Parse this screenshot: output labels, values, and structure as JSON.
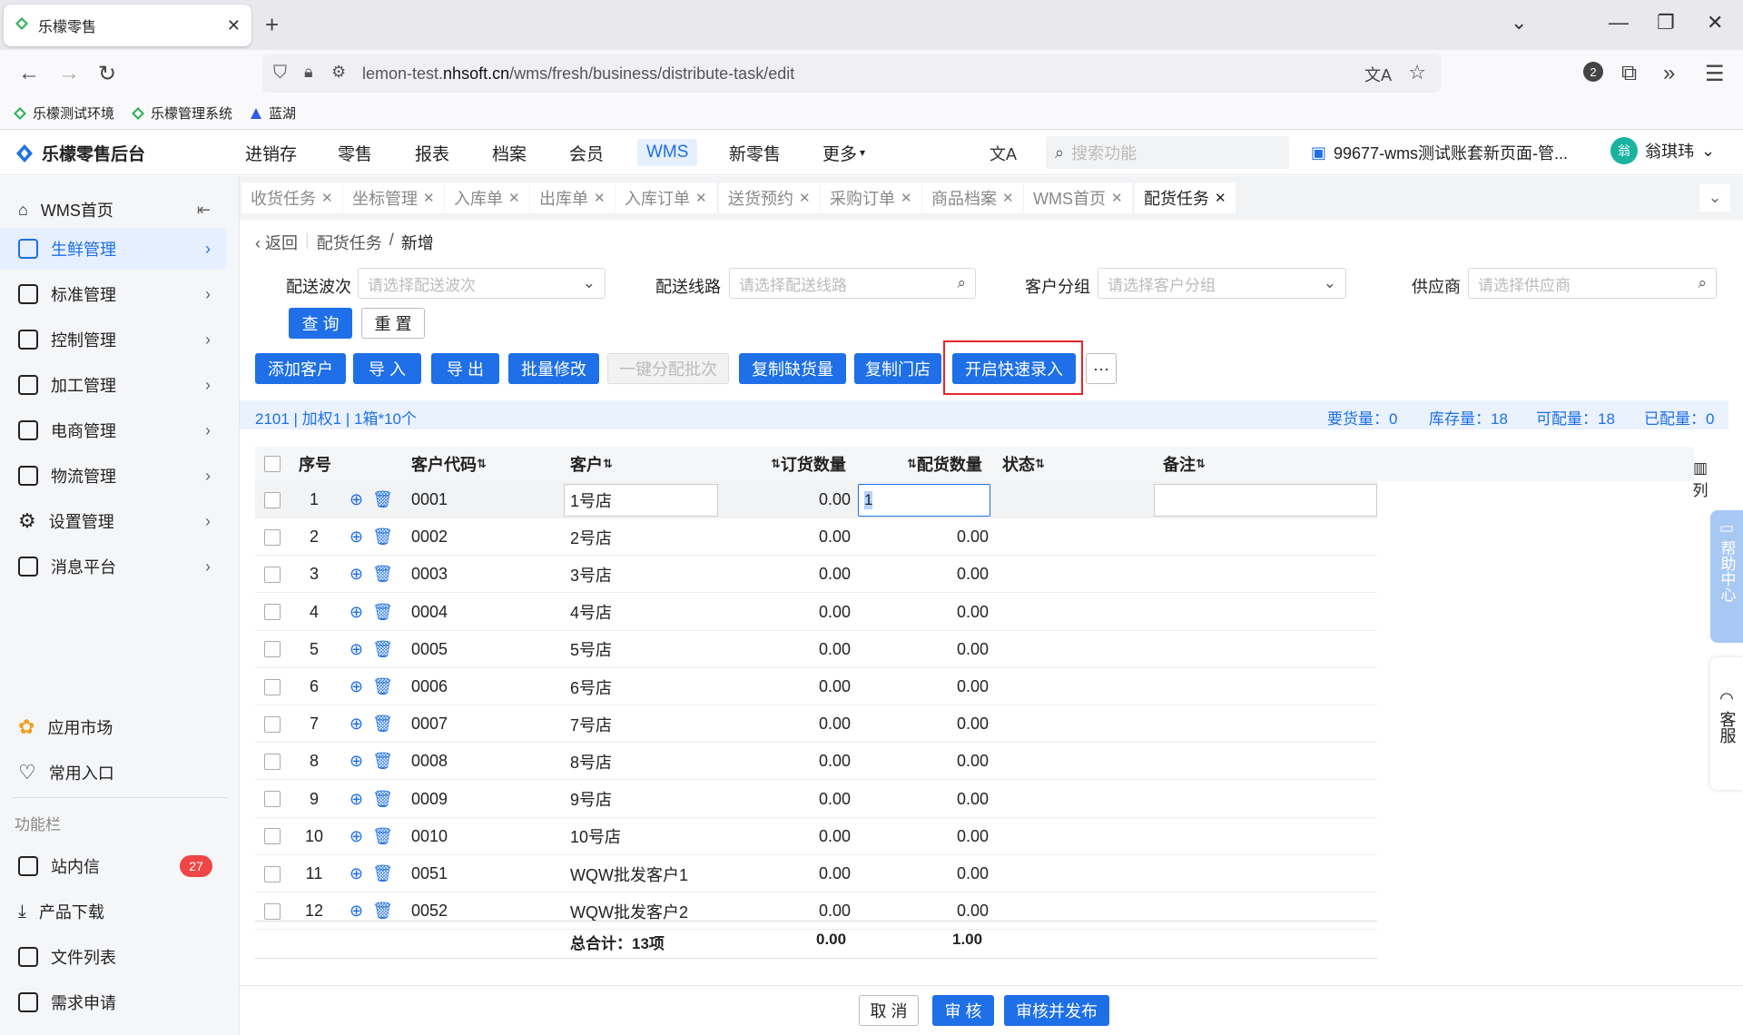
{
  "browser": {
    "tab_title": "乐檬零售",
    "tab_close": "✕",
    "new_tab": "+",
    "url_prefix": "lemon-test.",
    "url_domain": "nhsoft.cn",
    "url_path": "/wms/fresh/business/distribute-task/edit",
    "ext_badge": "2",
    "bookmarks": [
      "乐檬测试环境",
      "乐檬管理系统",
      "蓝湖"
    ]
  },
  "app": {
    "brand": "乐檬零售后台",
    "topnav": [
      "进销存",
      "零售",
      "报表",
      "档案",
      "会员",
      "WMS",
      "新零售",
      "更多"
    ],
    "search_placeholder": "搜索功能",
    "account": "99677-wms测试账套新页面-管...",
    "avatar_char": "翁",
    "user_name": "翁琪玮"
  },
  "sidebar": {
    "items": [
      "WMS首页",
      "生鲜管理",
      "标准管理",
      "控制管理",
      "加工管理",
      "电商管理",
      "物流管理",
      "设置管理",
      "消息平台"
    ],
    "bottom_items": [
      "应用市场",
      "常用入口"
    ],
    "section_label": "功能栏",
    "func_items": [
      "站内信",
      "产品下载",
      "文件列表",
      "需求申请"
    ],
    "badge": "27"
  },
  "page_tabs": [
    "收货任务",
    "坐标管理",
    "入库单",
    "出库单",
    "入库订单",
    "送货预约",
    "采购订单",
    "商品档案",
    "WMS首页",
    "配货任务"
  ],
  "breadcrumb": {
    "back": "返回",
    "parent": "配货任务",
    "sep": "/",
    "current": "新增"
  },
  "filters": {
    "wave_label": "配送波次",
    "wave_placeholder": "请选择配送波次",
    "route_label": "配送线路",
    "route_placeholder": "请选择配送线路",
    "group_label": "客户分组",
    "group_placeholder": "请选择客户分组",
    "supplier_label": "供应商",
    "supplier_placeholder": "请选择供应商",
    "query": "查 询",
    "reset": "重 置"
  },
  "toolbar": [
    "添加客户",
    "导 入",
    "导 出",
    "批量修改",
    "一键分配批次",
    "复制缺货量",
    "复制门店",
    "开启快速录入"
  ],
  "toolbar_more": "···",
  "info": {
    "product": "2101 | 加权1 | 1箱*10个",
    "demand": "要货量：0",
    "stock": "库存量：18",
    "allocatable": "可配量：18",
    "allocated": "已配量：0"
  },
  "table": {
    "headers": [
      "序号",
      "客户代码",
      "客户",
      "订货数量",
      "配货数量",
      "状态",
      "备注"
    ],
    "rows": [
      {
        "no": "1",
        "code": "0001",
        "customer": "1号店",
        "order": "0.00",
        "alloc": "1"
      },
      {
        "no": "2",
        "code": "0002",
        "customer": "2号店",
        "order": "0.00",
        "alloc": "0.00"
      },
      {
        "no": "3",
        "code": "0003",
        "customer": "3号店",
        "order": "0.00",
        "alloc": "0.00"
      },
      {
        "no": "4",
        "code": "0004",
        "customer": "4号店",
        "order": "0.00",
        "alloc": "0.00"
      },
      {
        "no": "5",
        "code": "0005",
        "customer": "5号店",
        "order": "0.00",
        "alloc": "0.00"
      },
      {
        "no": "6",
        "code": "0006",
        "customer": "6号店",
        "order": "0.00",
        "alloc": "0.00"
      },
      {
        "no": "7",
        "code": "0007",
        "customer": "7号店",
        "order": "0.00",
        "alloc": "0.00"
      },
      {
        "no": "8",
        "code": "0008",
        "customer": "8号店",
        "order": "0.00",
        "alloc": "0.00"
      },
      {
        "no": "9",
        "code": "0009",
        "customer": "9号店",
        "order": "0.00",
        "alloc": "0.00"
      },
      {
        "no": "10",
        "code": "0010",
        "customer": "10号店",
        "order": "0.00",
        "alloc": "0.00"
      },
      {
        "no": "11",
        "code": "0051",
        "customer": "WQW批发客户1",
        "order": "0.00",
        "alloc": "0.00"
      },
      {
        "no": "12",
        "code": "0052",
        "customer": "WQW批发客户2",
        "order": "0.00",
        "alloc": "0.00"
      }
    ],
    "total_label": "总合计：13项",
    "total_order": "0.00",
    "total_alloc": "1.00",
    "col_setting": "列"
  },
  "side_help": {
    "help": "帮助中心",
    "service": "客服"
  },
  "footer": {
    "cancel": "取 消",
    "audit": "审 核",
    "audit_publish": "审核并发布"
  },
  "colors": {
    "primary": "#1e6fe8",
    "highlight": "#e8242a",
    "badge": "#f04646"
  }
}
